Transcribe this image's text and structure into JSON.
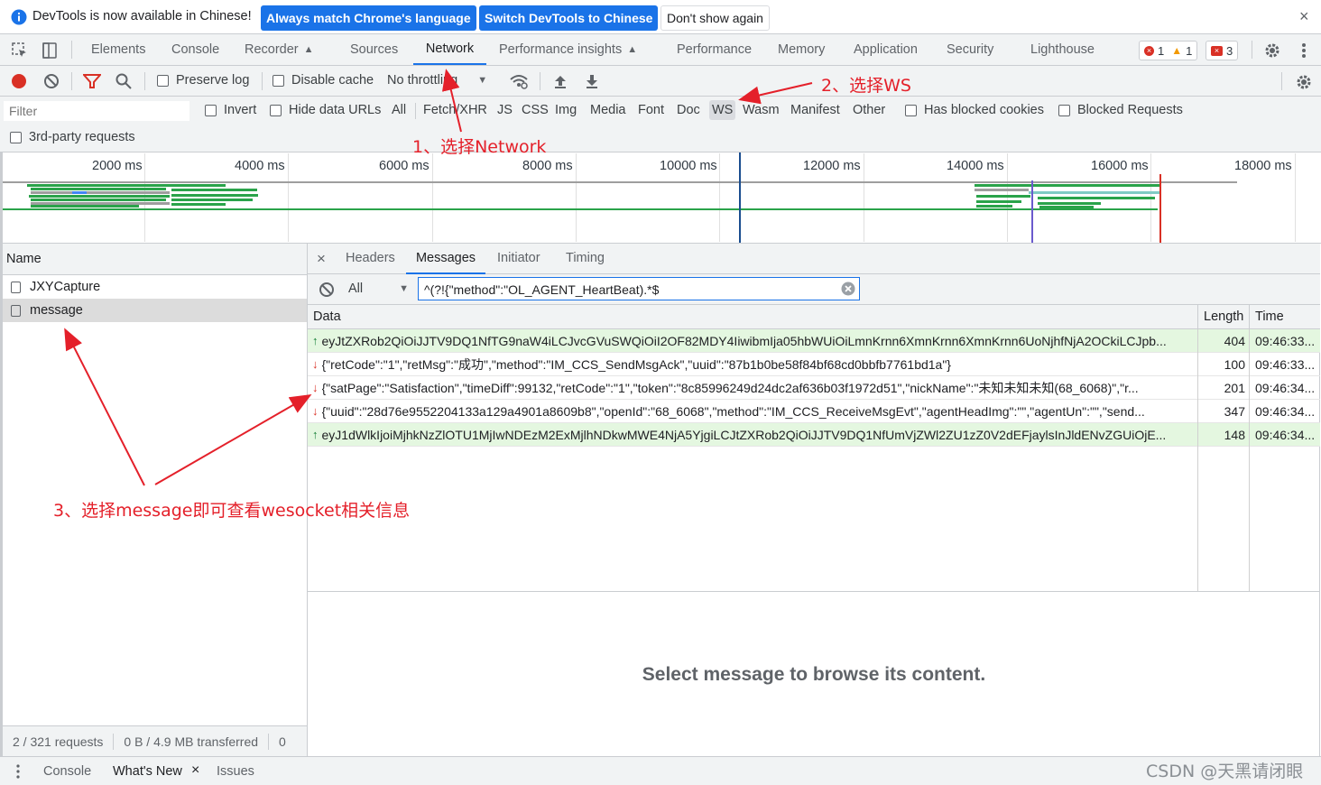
{
  "infobar": {
    "message": "DevTools is now available in Chinese!",
    "btn_match": "Always match Chrome's language",
    "btn_switch": "Switch DevTools to Chinese",
    "btn_dont": "Don't show again",
    "close": "×"
  },
  "tabs": [
    "Elements",
    "Console",
    "Recorder",
    "Sources",
    "Network",
    "Performance insights",
    "Performance",
    "Memory",
    "Application",
    "Security",
    "Lighthouse"
  ],
  "badges": {
    "errors": "1",
    "warnings": "1",
    "issues": "3"
  },
  "toolbar": {
    "preserve_log": "Preserve log",
    "disable_cache": "Disable cache",
    "throttling": "No throttling"
  },
  "filter": {
    "placeholder": "Filter",
    "invert": "Invert",
    "hide_data_urls": "Hide data URLs",
    "types": [
      "All",
      "Fetch/XHR",
      "JS",
      "CSS",
      "Img",
      "Media",
      "Font",
      "Doc",
      "WS",
      "Wasm",
      "Manifest",
      "Other"
    ],
    "has_blocked_cookies": "Has blocked cookies",
    "blocked_requests": "Blocked Requests",
    "third_party": "3rd-party requests"
  },
  "timeline": {
    "ticks": [
      "2000 ms",
      "4000 ms",
      "6000 ms",
      "8000 ms",
      "10000 ms",
      "12000 ms",
      "14000 ms",
      "16000 ms",
      "18000 ms"
    ]
  },
  "requests": {
    "header": "Name",
    "items": [
      "JXYCapture",
      "message"
    ],
    "status_requests": "2 / 321 requests",
    "status_transferred": "0 B / 4.9 MB transferred",
    "status_extra": "0"
  },
  "detail": {
    "close": "×",
    "tabs": [
      "Headers",
      "Messages",
      "Initiator",
      "Timing"
    ],
    "msg_filter_type": "All",
    "msg_filter_value": "^(?!{\"method\":\"OL_AGENT_HeartBeat).*$",
    "col_data": "Data",
    "col_length": "Length",
    "col_time": "Time",
    "messages": [
      {
        "dir": "sent",
        "data": "eyJtZXRob2QiOiJJTV9DQ1NfTG9naW4iLCJvcGVuSWQiOiI2OF82MDY4IiwibmIja05hbWUiOiLmnKrnn6XmnKrnn6XmnKrnn6UoNjhfNjA2OCkiLCJpb...",
        "length": "404",
        "time": "09:46:33..."
      },
      {
        "dir": "recv",
        "data": "{\"retCode\":\"1\",\"retMsg\":\"成功\",\"method\":\"IM_CCS_SendMsgAck\",\"uuid\":\"87b1b0be58f84bf68cd0bbfb7761bd1a\"}",
        "length": "100",
        "time": "09:46:33..."
      },
      {
        "dir": "recv",
        "data": "{\"satPage\":\"Satisfaction\",\"timeDiff\":99132,\"retCode\":\"1\",\"token\":\"8c85996249d24dc2af636b03f1972d51\",\"nickName\":\"未知未知未知(68_6068)\",\"r...",
        "length": "201",
        "time": "09:46:34..."
      },
      {
        "dir": "recv",
        "data": "{\"uuid\":\"28d76e9552204133a129a4901a8609b8\",\"openId\":\"68_6068\",\"method\":\"IM_CCS_ReceiveMsgEvt\",\"agentHeadImg\":\"\",\"agentUn\":\"\",\"send...",
        "length": "347",
        "time": "09:46:34..."
      },
      {
        "dir": "sent",
        "data": "eyJ1dWlkIjoiMjhkNzZlOTU1MjIwNDEzM2ExMjlhNDkwMWE4NjA5YjgiLCJtZXRob2QiOiJJTV9DQ1NfUmVjZWl2ZU1zZ0V2dEFjaylsInJldENvZGUiOjE...",
        "length": "148",
        "time": "09:46:34..."
      }
    ],
    "placeholder": "Select message to browse its content."
  },
  "drawer": {
    "items": [
      "Console",
      "What's New",
      "Issues"
    ],
    "close": "×"
  },
  "annotations": {
    "a1": "1、选择Network",
    "a2": "2、选择WS",
    "a3": "3、选择message即可查看wesocket相关信息"
  },
  "watermark": "CSDN @天黑请闭眼"
}
